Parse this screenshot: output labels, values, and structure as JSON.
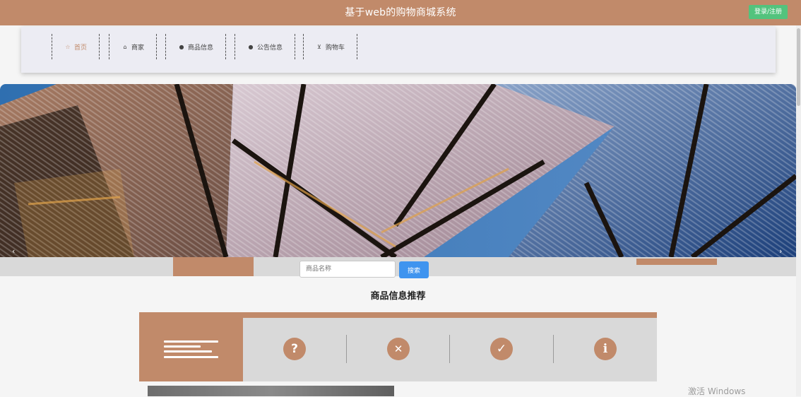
{
  "header": {
    "title": "基于web的购物商城系统",
    "login_button": "登录/注册",
    "bg_color": "#c18a6a"
  },
  "nav": {
    "items": [
      {
        "label": "首页",
        "icon": "star-icon",
        "active": true
      },
      {
        "label": "商家",
        "icon": "shop-icon",
        "active": false
      },
      {
        "label": "商品信息",
        "icon": "info-circle-icon",
        "active": false
      },
      {
        "label": "公告信息",
        "icon": "question-circle-icon",
        "active": false
      },
      {
        "label": "购物车",
        "icon": "cart-icon",
        "active": false
      }
    ]
  },
  "banner": {
    "prev": "‹",
    "next": "›"
  },
  "search": {
    "placeholder": "商品名称",
    "button": "搜索"
  },
  "section": {
    "title": "商品信息推荐"
  },
  "recommend": {
    "icons": [
      {
        "name": "question-icon",
        "glyph": "?"
      },
      {
        "name": "close-icon",
        "glyph": "✕"
      },
      {
        "name": "check-icon",
        "glyph": "✓"
      },
      {
        "name": "info-icon",
        "glyph": "i"
      }
    ],
    "accent": "#c18a6a"
  },
  "watermark": {
    "text": "激活 Windows"
  }
}
